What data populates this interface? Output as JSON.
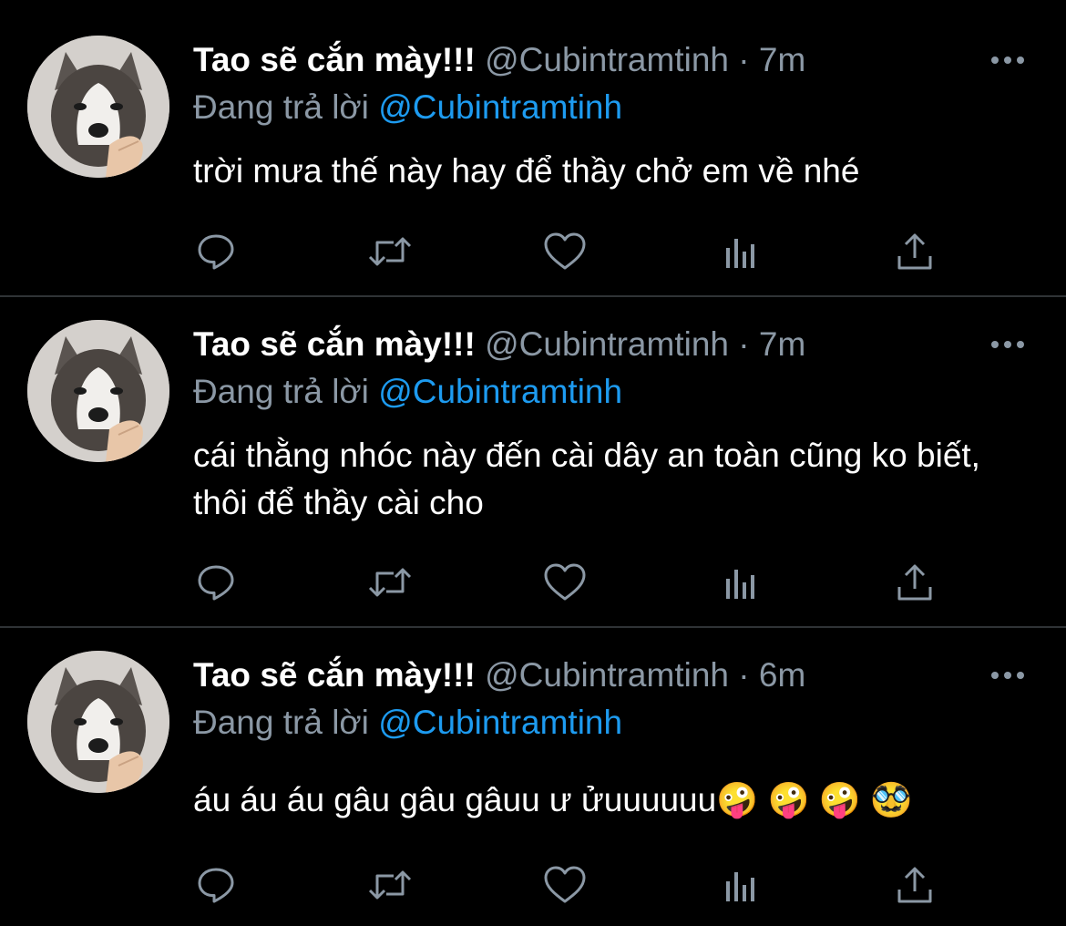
{
  "theme": {
    "background": "#000000",
    "text": "#ffffff",
    "secondary": "#8b98a5",
    "link": "#1d9bf0",
    "divider": "#2f3336"
  },
  "tweets": [
    {
      "display_name": "Tao sẽ cắn mày!!!",
      "handle": "@Cubintramtinh",
      "dot": "·",
      "time": "7m",
      "replying_label": "Đang trả lời",
      "replying_to": "@Cubintramtinh",
      "text": "trời mưa thế này hay để thầy chở em về nhé",
      "avatar": "husky-dog-avatar"
    },
    {
      "display_name": "Tao sẽ cắn mày!!!",
      "handle": "@Cubintramtinh",
      "dot": "·",
      "time": "7m",
      "replying_label": "Đang trả lời",
      "replying_to": "@Cubintramtinh",
      "text": "cái thằng nhóc này đến cài dây an toàn cũng ko biết, thôi để thầy cài cho",
      "avatar": "husky-dog-avatar"
    },
    {
      "display_name": "Tao sẽ cắn mày!!!",
      "handle": "@Cubintramtinh",
      "dot": "·",
      "time": "6m",
      "replying_label": "Đang trả lời",
      "replying_to": "@Cubintramtinh",
      "text": "áu áu áu gâu gâu gâuu ư ửuuuuuu🤪 🤪 🤪 🥸",
      "avatar": "husky-dog-avatar"
    }
  ],
  "action_icons": [
    "reply-icon",
    "retweet-icon",
    "like-icon",
    "analytics-icon",
    "share-icon"
  ],
  "more_icon": "more-options-icon"
}
